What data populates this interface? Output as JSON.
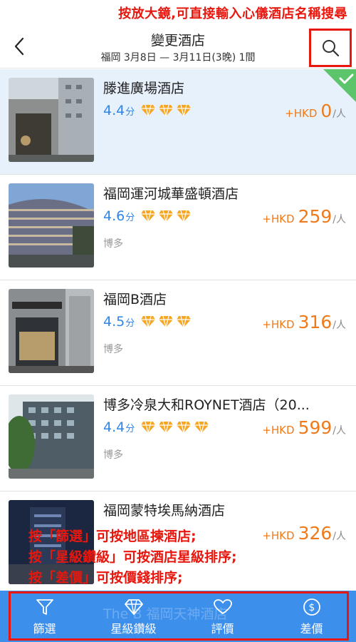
{
  "annotation_top": "按放大鏡,可直接輸入心儀酒店名稱搜尋",
  "header": {
    "title": "變更酒店",
    "subtitle": "福岡 3月8日 — 3月11日(3晚) 1間"
  },
  "colors": {
    "accent": "#3d8fec",
    "price": "#f07a1a",
    "score": "#2f86e8",
    "annotation": "#e8170e",
    "diamond": "#f5a623"
  },
  "hotels": [
    {
      "name": "滕進廣場酒店",
      "score": "4.4",
      "score_unit": "分",
      "diamonds": 3,
      "district": "",
      "currency": "+HKD",
      "price": "0",
      "per": "/人",
      "selected": true
    },
    {
      "name": "福岡運河城華盛頓酒店",
      "score": "4.6",
      "score_unit": "分",
      "diamonds": 3,
      "district": "博多",
      "currency": "+HKD",
      "price": "259",
      "per": "/人",
      "selected": false
    },
    {
      "name": "福岡B酒店",
      "score": "4.5",
      "score_unit": "分",
      "diamonds": 3,
      "district": "博多",
      "currency": "+HKD",
      "price": "316",
      "per": "/人",
      "selected": false
    },
    {
      "name": "博多冷泉大和ROYNET酒店（20...",
      "score": "4.4",
      "score_unit": "分",
      "diamonds": 4,
      "district": "博多",
      "currency": "+HKD",
      "price": "599",
      "per": "/人",
      "selected": false
    },
    {
      "name": "福岡蒙特埃馬納酒店",
      "score": "",
      "score_unit": "",
      "diamonds": 0,
      "district": "",
      "currency": "+HKD",
      "price": "326",
      "per": "/人",
      "selected": false
    }
  ],
  "partial_hotel_name": "The B 福岡天神酒店",
  "annotation_notes": [
    "按「篩選」可按地區揀酒店;",
    "按「星級鑽級」可按酒店星級排序;",
    "按「差價」可按價錢排序;"
  ],
  "bottom_tabs": [
    {
      "label": "篩選",
      "icon": "filter-icon"
    },
    {
      "label": "星級鑽級",
      "icon": "diamond-icon"
    },
    {
      "label": "評價",
      "icon": "heart-icon"
    },
    {
      "label": "差價",
      "icon": "dollar-icon"
    }
  ]
}
